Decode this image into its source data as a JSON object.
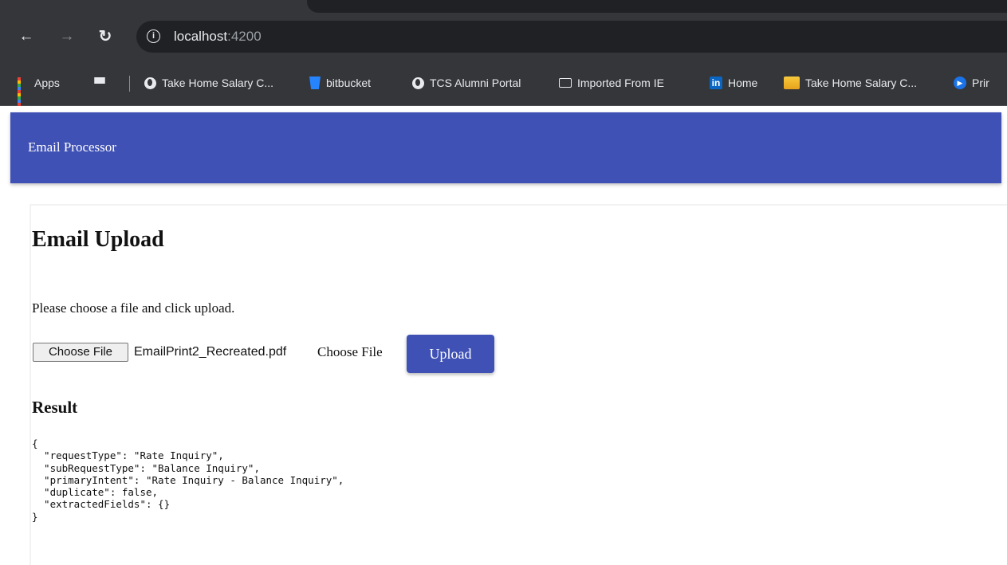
{
  "browser": {
    "url_host": "localhost",
    "url_port": ":4200",
    "bookmarks": [
      {
        "label": "Apps",
        "icon": "apps-grid-icon"
      },
      {
        "label": "",
        "icon": "tab-groups-icon"
      },
      {
        "label": "Take Home Salary C...",
        "icon": "globe-icon"
      },
      {
        "label": "bitbucket",
        "icon": "bitbucket-icon"
      },
      {
        "label": "TCS Alumni Portal",
        "icon": "globe-icon"
      },
      {
        "label": "Imported From IE",
        "icon": "folder-icon"
      },
      {
        "label": "Home",
        "icon": "linkedin-icon"
      },
      {
        "label": "Take Home Salary C...",
        "icon": "document-icon"
      },
      {
        "label": "Prir",
        "icon": "play-icon"
      }
    ]
  },
  "app": {
    "title": "Email Processor"
  },
  "page": {
    "heading": "Email Upload",
    "instructions": "Please choose a file and click upload.",
    "file_button_label": "Choose File",
    "selected_file": "EmailPrint2_Recreated.pdf",
    "choose_file_text": "Choose File",
    "upload_label": "Upload",
    "result_heading": "Result",
    "result_json": "{\n  \"requestType\": \"Rate Inquiry\",\n  \"subRequestType\": \"Balance Inquiry\",\n  \"primaryIntent\": \"Rate Inquiry - Balance Inquiry\",\n  \"duplicate\": false,\n  \"extractedFields\": {}\n}"
  },
  "colors": {
    "primary": "#3f51b5",
    "chrome_dark": "#35363a"
  }
}
